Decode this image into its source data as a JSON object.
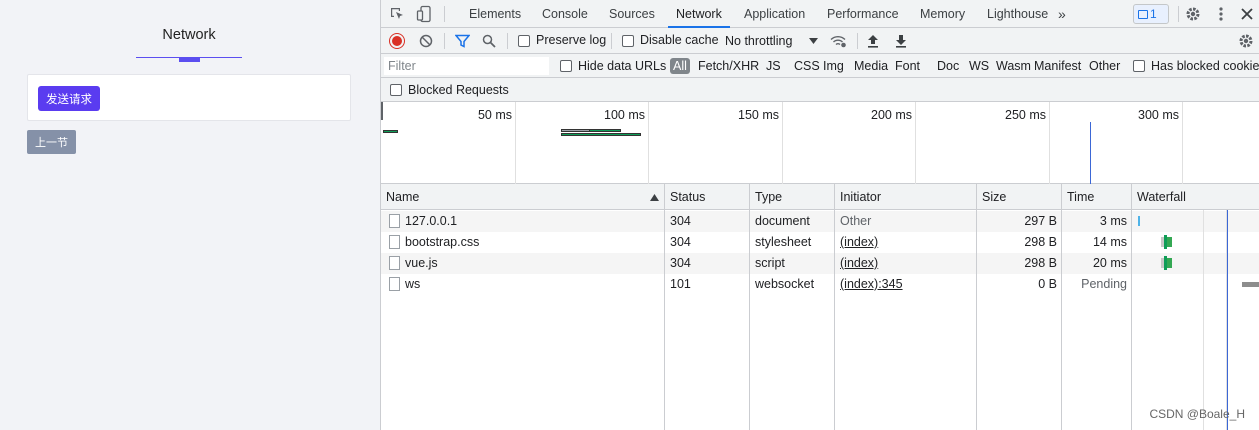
{
  "app": {
    "title": "Network",
    "send_button": "发送请求",
    "prev_button": "上一节"
  },
  "devtools": {
    "tabs": [
      {
        "label": "Elements"
      },
      {
        "label": "Console"
      },
      {
        "label": "Sources"
      },
      {
        "label": "Network",
        "active": true
      },
      {
        "label": "Application"
      },
      {
        "label": "Performance"
      },
      {
        "label": "Memory"
      },
      {
        "label": "Lighthouse"
      }
    ],
    "more_tabs": "»",
    "issues_count": "1",
    "toolbar": {
      "preserve_log": "Preserve log",
      "disable_cache": "Disable cache",
      "throttling": "No throttling"
    },
    "filter": {
      "placeholder": "Filter",
      "hide_data_urls": "Hide data URLs",
      "types": [
        "All",
        "Fetch/XHR",
        "JS",
        "CSS",
        "Img",
        "Media",
        "Font",
        "Doc",
        "WS",
        "Wasm",
        "Manifest",
        "Other"
      ],
      "has_blocked_cookies": "Has blocked cookies",
      "blocked_requests": "Blocked Requests"
    },
    "overview": {
      "tick_labels": [
        "50 ms",
        "100 ms",
        "150 ms",
        "200 ms",
        "250 ms",
        "300 ms"
      ]
    },
    "columns": {
      "name": "Name",
      "status": "Status",
      "type": "Type",
      "initiator": "Initiator",
      "size": "Size",
      "time": "Time",
      "waterfall": "Waterfall"
    },
    "requests": [
      {
        "name": "127.0.0.1",
        "status": "304",
        "type": "document",
        "initiator": "Other",
        "size": "297 B",
        "time": "3 ms"
      },
      {
        "name": "bootstrap.css",
        "status": "304",
        "type": "stylesheet",
        "initiator": "(index)",
        "size": "298 B",
        "time": "14 ms"
      },
      {
        "name": "vue.js",
        "status": "304",
        "type": "script",
        "initiator": "(index)",
        "size": "298 B",
        "time": "20 ms"
      },
      {
        "name": "ws",
        "status": "101",
        "type": "websocket",
        "initiator": "(index):345",
        "size": "0 B",
        "time": "Pending"
      }
    ]
  },
  "watermark": "CSDN @Boale_H",
  "colors": {
    "accent": "#5a3cf0",
    "record": "#d93025",
    "devtools_blue": "#1a73e8"
  }
}
